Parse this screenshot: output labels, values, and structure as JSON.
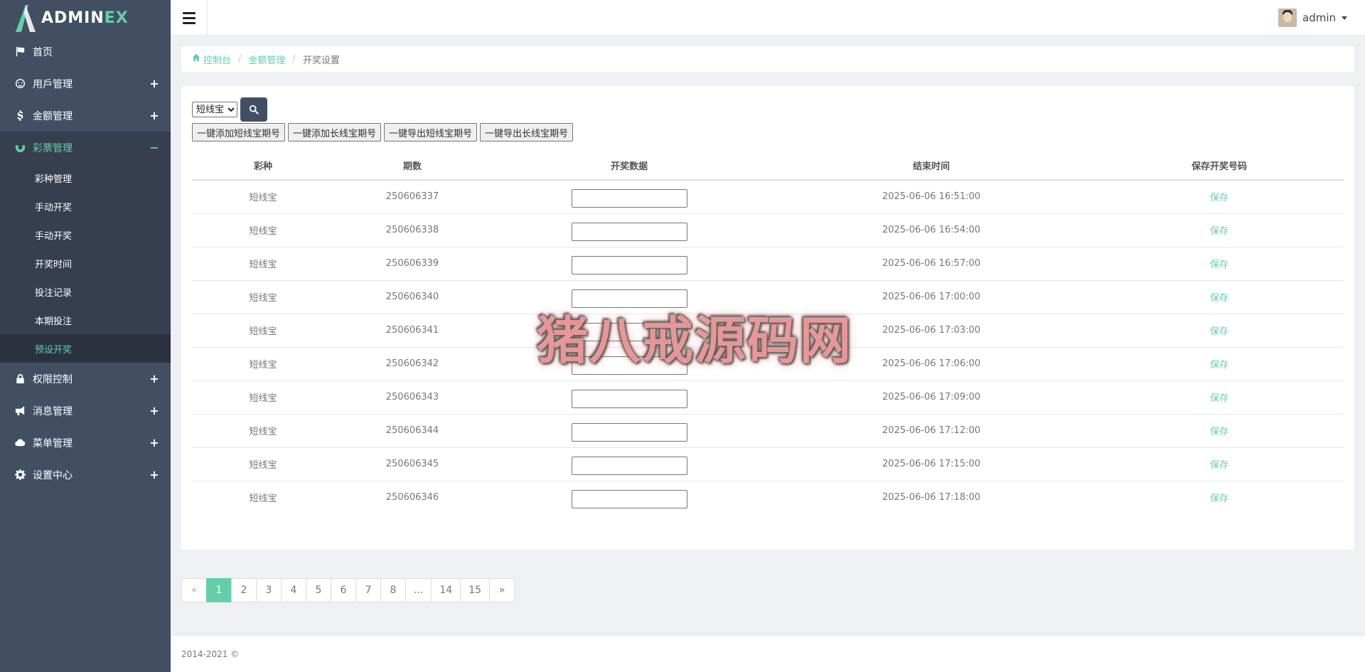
{
  "logo": {
    "text_main": "ADMIN",
    "text_accent": "EX"
  },
  "sidebar": {
    "items": [
      {
        "label": "首页",
        "icon": "flag-icon",
        "toggle": ""
      },
      {
        "label": "用戶管理",
        "icon": "user-icon",
        "toggle": "+"
      },
      {
        "label": "金额管理",
        "icon": "dollar-icon",
        "toggle": "+"
      },
      {
        "label": "彩票管理",
        "icon": "magnet-icon",
        "toggle": "−"
      },
      {
        "label": "权限控制",
        "icon": "lock-icon",
        "toggle": "+"
      },
      {
        "label": "消息管理",
        "icon": "bullhorn-icon",
        "toggle": "+"
      },
      {
        "label": "菜单管理",
        "icon": "cloud-icon",
        "toggle": "+"
      },
      {
        "label": "设置中心",
        "icon": "gear-icon",
        "toggle": "+"
      }
    ],
    "submenu": [
      "彩种管理",
      "手动开奖",
      "手动开奖",
      "开奖时间",
      "投注记录",
      "本期投注",
      "预设开奖"
    ]
  },
  "header": {
    "username": "admin"
  },
  "breadcrumb": {
    "home": "控制台",
    "parent": "金额管理",
    "current": "开奖设置",
    "sep": "/"
  },
  "toolbar": {
    "select_value": "短线宝",
    "buttons": [
      "一键添加短线宝期号",
      "一键添加长线宝期号",
      "一键导出短线宝期号",
      "一键导出长线宝期号"
    ]
  },
  "table": {
    "headers": [
      "彩种",
      "期数",
      "开奖数据",
      "结束时间",
      "保存开奖号码"
    ],
    "rows": [
      {
        "type": "短线宝",
        "period": "250606337",
        "end": "2025-06-06 16:51:00",
        "action": "保存"
      },
      {
        "type": "短线宝",
        "period": "250606338",
        "end": "2025-06-06 16:54:00",
        "action": "保存"
      },
      {
        "type": "短线宝",
        "period": "250606339",
        "end": "2025-06-06 16:57:00",
        "action": "保存"
      },
      {
        "type": "短线宝",
        "period": "250606340",
        "end": "2025-06-06 17:00:00",
        "action": "保存"
      },
      {
        "type": "短线宝",
        "period": "250606341",
        "end": "2025-06-06 17:03:00",
        "action": "保存"
      },
      {
        "type": "短线宝",
        "period": "250606342",
        "end": "2025-06-06 17:06:00",
        "action": "保存"
      },
      {
        "type": "短线宝",
        "period": "250606343",
        "end": "2025-06-06 17:09:00",
        "action": "保存"
      },
      {
        "type": "短线宝",
        "period": "250606344",
        "end": "2025-06-06 17:12:00",
        "action": "保存"
      },
      {
        "type": "短线宝",
        "period": "250606345",
        "end": "2025-06-06 17:15:00",
        "action": "保存"
      },
      {
        "type": "短线宝",
        "period": "250606346",
        "end": "2025-06-06 17:18:00",
        "action": "保存"
      }
    ]
  },
  "pagination": [
    "«",
    "1",
    "2",
    "3",
    "4",
    "5",
    "6",
    "7",
    "8",
    "...",
    "14",
    "15",
    "»"
  ],
  "pagination_active": "1",
  "footer": {
    "text": "2014-2021 ©"
  },
  "watermark": "猪八戒源码网",
  "colors": {
    "accent": "#65cea7",
    "sidebar": "#424f63",
    "sidebar_active": "#353f4f"
  }
}
